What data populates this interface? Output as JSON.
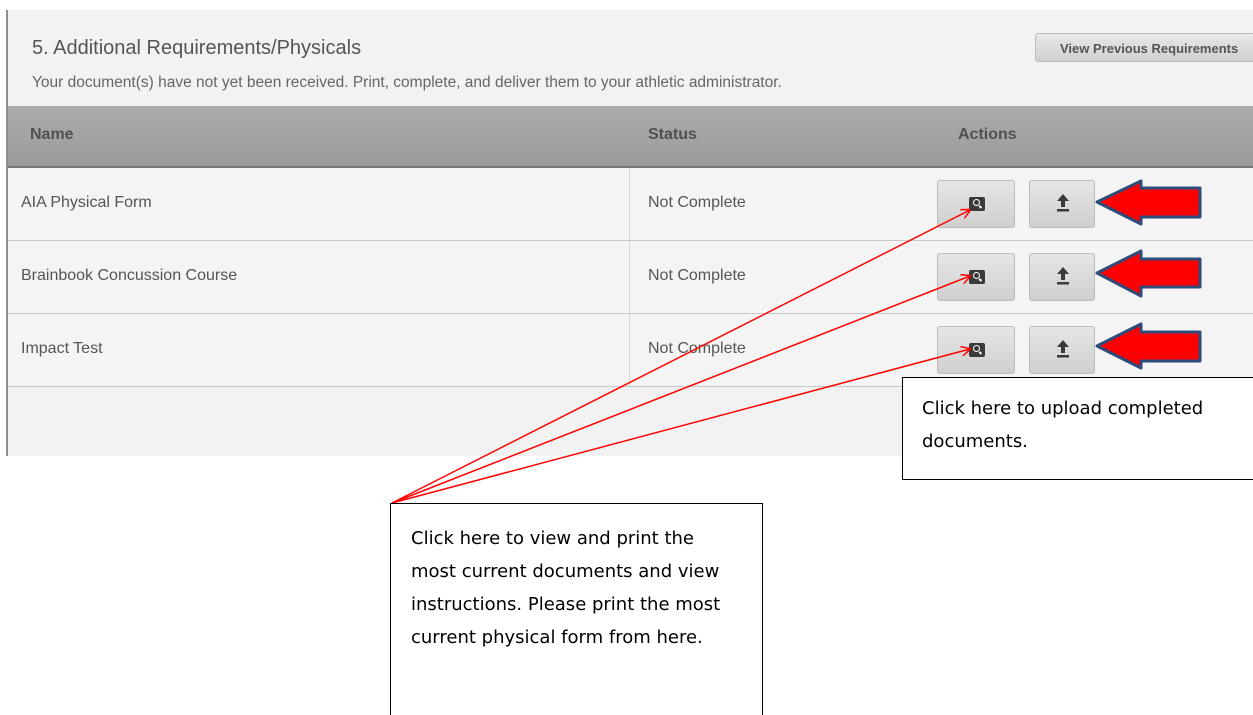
{
  "section": {
    "title": "5. Additional Requirements/Physicals",
    "subtitle": "Your document(s) have not yet been received. Print, complete, and deliver them to your athletic administrator.",
    "view_previous_label": "View Previous Requirements"
  },
  "table": {
    "columns": [
      "Name",
      "Status",
      "Actions"
    ],
    "rows": [
      {
        "name": "AIA Physical Form",
        "status": "Not Complete"
      },
      {
        "name": "Brainbook Concussion Course",
        "status": "Not Complete"
      },
      {
        "name": "Impact Test",
        "status": "Not Complete"
      }
    ]
  },
  "icons": {
    "view": "view-document-icon",
    "upload": "upload-icon",
    "callout_arrow": "red-arrow-icon"
  },
  "annotations": {
    "upload_note": "Click here to upload completed documents.",
    "view_note": "Click here to view and print the most current documents and view instructions. Please print the most current physical form from here."
  },
  "colors": {
    "arrow_fill": "#ff0000",
    "arrow_stroke": "#2e4b7a",
    "callout_line": "#ff0000",
    "header_bg": "#a6a6a6"
  }
}
